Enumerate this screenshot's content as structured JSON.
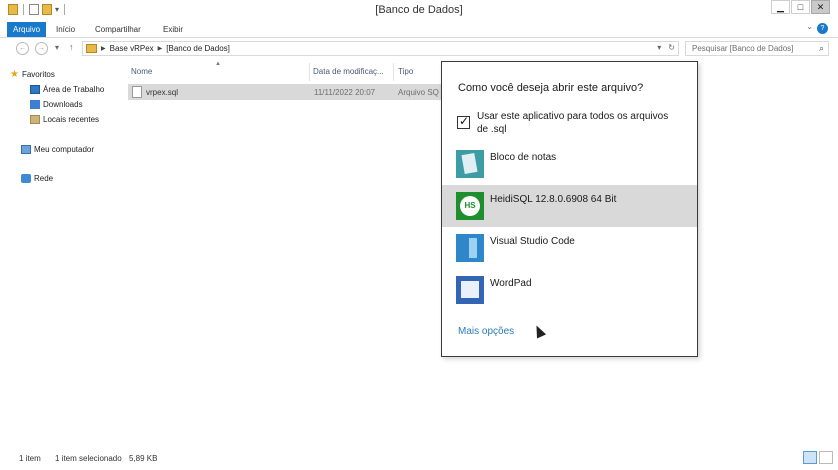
{
  "window": {
    "title": "[Banco de Dados]",
    "buttons": [
      "minimize",
      "maximize",
      "close"
    ]
  },
  "ribbon": {
    "tabs": [
      {
        "label": "Arquivo",
        "active": true
      },
      {
        "label": "Início",
        "active": false
      },
      {
        "label": "Compartilhar",
        "active": false
      },
      {
        "label": "Exibir",
        "active": false
      }
    ],
    "help_label": "?"
  },
  "address_bar": {
    "breadcrumb": [
      "Base vRPex",
      "[Banco de Dados]"
    ],
    "search_placeholder": "Pesquisar [Banco de Dados]"
  },
  "sidebar": {
    "favorites_label": "Favoritos",
    "favorites": [
      {
        "label": "Área de Trabalho",
        "icon": "desktop-icon"
      },
      {
        "label": "Downloads",
        "icon": "downloads-icon"
      },
      {
        "label": "Locais recentes",
        "icon": "recent-places-icon"
      }
    ],
    "computer_label": "Meu computador",
    "network_label": "Rede"
  },
  "file_list": {
    "columns": [
      "Nome",
      "Data de modificaç...",
      "Tipo"
    ],
    "files": [
      {
        "name": "vrpex.sql",
        "date": "11/11/2022 20:07",
        "type": "Arquivo SQ",
        "selected": true
      }
    ]
  },
  "status_bar": {
    "item_count": "1 item",
    "selection": "1 item selecionado",
    "size": "5,89 KB"
  },
  "open_with": {
    "title": "Como você deseja abrir este arquivo?",
    "always_use_label": "Usar este aplicativo para todos os arquivos de .sql",
    "always_use_checked": true,
    "apps": [
      {
        "label": "Bloco de notas",
        "icon": "notepad-icon"
      },
      {
        "label": "HeidiSQL 12.8.0.6908 64 Bit",
        "icon": "heidisql-icon",
        "hovered": true,
        "icon_text": "HS"
      },
      {
        "label": "Visual Studio Code",
        "icon": "vscode-icon"
      },
      {
        "label": "WordPad",
        "icon": "wordpad-icon"
      }
    ],
    "more_label": "Mais opções"
  },
  "colors": {
    "accent": "#1979ca",
    "hover": "#d9d9d9",
    "link": "#2a7ab9"
  }
}
